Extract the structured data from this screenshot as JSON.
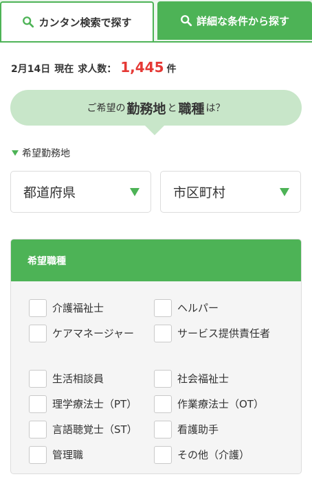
{
  "tabs": {
    "simple_label": "カンタン検索で探す",
    "detail_label": "詳細な条件から探す",
    "simple_icon": "search-icon",
    "detail_icon": "search-icon"
  },
  "stats": {
    "date": "2月14日",
    "now_label": "現在",
    "jobs_label": "求人数：",
    "count": "1,445",
    "unit": "件"
  },
  "bubble": {
    "prefix": "ご希望の",
    "emph1": "勤務地",
    "mid": "と",
    "emph2": "職種",
    "suffix": "は？"
  },
  "area": {
    "label": "希望勤務地",
    "prefecture_placeholder": "都道府県",
    "city_placeholder": "市区町村"
  },
  "job": {
    "header": "希望職種",
    "options": [
      "介護福祉士",
      "ヘルパー",
      "ケアマネージャー",
      "サービス提供責任者",
      "生活相談員",
      "社会福祉士",
      "理学療法士（PT）",
      "作業療法士（OT）",
      "言語聴覚士（ST）",
      "看護助手",
      "管理職",
      "その他（介護）"
    ]
  },
  "colors": {
    "accent": "#4db356",
    "bubble": "#c8e6c9",
    "count": "#e53935"
  }
}
